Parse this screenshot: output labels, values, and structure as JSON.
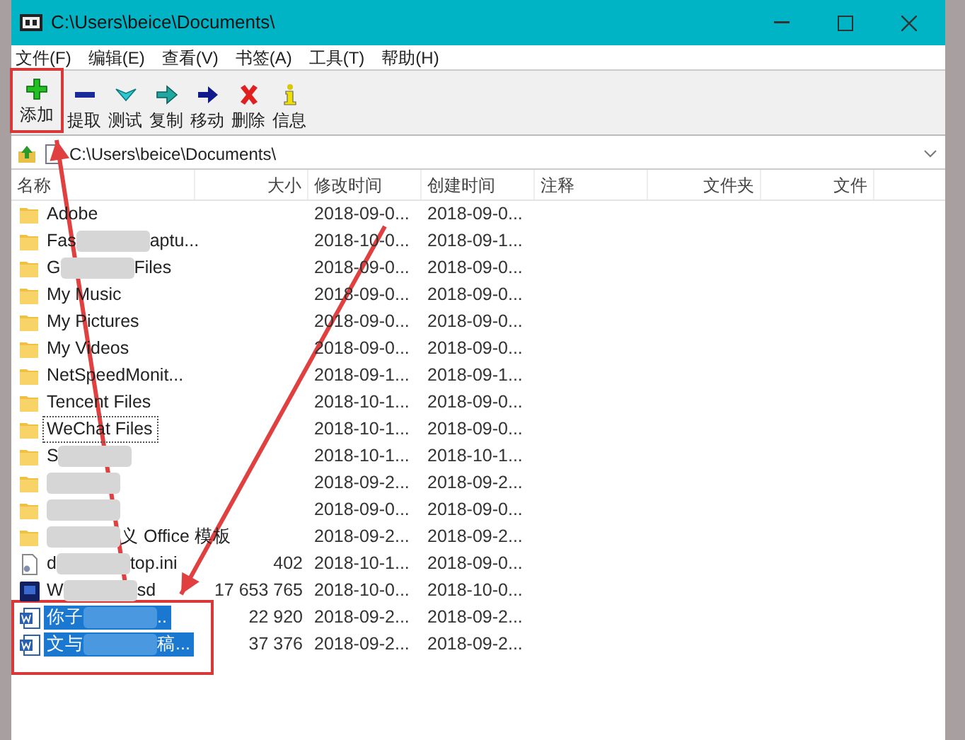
{
  "window": {
    "title": "C:\\Users\\beice\\Documents\\"
  },
  "menu": [
    "文件(F)",
    "编辑(E)",
    "查看(V)",
    "书签(A)",
    "工具(T)",
    "帮助(H)"
  ],
  "toolbar": [
    {
      "kind": "add",
      "label": "添加",
      "highlighted": true
    },
    {
      "kind": "extract",
      "label": "提取",
      "highlighted": false
    },
    {
      "kind": "test",
      "label": "测试",
      "highlighted": false
    },
    {
      "kind": "copy",
      "label": "复制",
      "highlighted": false
    },
    {
      "kind": "move",
      "label": "移动",
      "highlighted": false
    },
    {
      "kind": "delete",
      "label": "删除",
      "highlighted": false
    },
    {
      "kind": "info",
      "label": "信息",
      "highlighted": false
    }
  ],
  "address": {
    "path": "C:\\Users\\beice\\Documents\\"
  },
  "columns": [
    {
      "label": "名称"
    },
    {
      "label": "大小"
    },
    {
      "label": "修改时间"
    },
    {
      "label": "创建时间"
    },
    {
      "label": "注释"
    },
    {
      "label": "文件夹"
    },
    {
      "label": "文件"
    }
  ],
  "rows": [
    {
      "kind": "folder",
      "name": [
        {
          "kind": "text",
          "text": "Adobe"
        }
      ],
      "modified": "2018-09-0...",
      "created": "2018-09-0...",
      "selected": false,
      "focused": false
    },
    {
      "kind": "folder",
      "name": [
        {
          "kind": "text",
          "text": "Fas"
        },
        {
          "kind": "blur"
        },
        {
          "kind": "text",
          "text": "aptu..."
        }
      ],
      "modified": "2018-10-0...",
      "created": "2018-09-1...",
      "selected": false,
      "focused": false
    },
    {
      "kind": "folder",
      "name": [
        {
          "kind": "text",
          "text": "G"
        },
        {
          "kind": "blur"
        },
        {
          "kind": "text",
          "text": "Files"
        }
      ],
      "modified": "2018-09-0...",
      "created": "2018-09-0...",
      "selected": false,
      "focused": false
    },
    {
      "kind": "folder",
      "name": [
        {
          "kind": "text",
          "text": "My Music"
        }
      ],
      "modified": "2018-09-0...",
      "created": "2018-09-0...",
      "selected": false,
      "focused": false
    },
    {
      "kind": "folder",
      "name": [
        {
          "kind": "text",
          "text": "My Pictures"
        }
      ],
      "modified": "2018-09-0...",
      "created": "2018-09-0...",
      "selected": false,
      "focused": false
    },
    {
      "kind": "folder",
      "name": [
        {
          "kind": "text",
          "text": "My Videos"
        }
      ],
      "modified": "2018-09-0...",
      "created": "2018-09-0...",
      "selected": false,
      "focused": false
    },
    {
      "kind": "folder",
      "name": [
        {
          "kind": "text",
          "text": "NetSpeedMonit..."
        }
      ],
      "modified": "2018-09-1...",
      "created": "2018-09-1...",
      "selected": false,
      "focused": false
    },
    {
      "kind": "folder",
      "name": [
        {
          "kind": "text",
          "text": "Tencent Files"
        }
      ],
      "modified": "2018-10-1...",
      "created": "2018-09-0...",
      "selected": false,
      "focused": false
    },
    {
      "kind": "folder",
      "name": [
        {
          "kind": "text",
          "text": "WeChat Files"
        }
      ],
      "modified": "2018-10-1...",
      "created": "2018-09-0...",
      "selected": false,
      "focused": true
    },
    {
      "kind": "folder",
      "name": [
        {
          "kind": "text",
          "text": "S"
        },
        {
          "kind": "blur"
        }
      ],
      "modified": "2018-10-1...",
      "created": "2018-10-1...",
      "selected": false,
      "focused": false
    },
    {
      "kind": "folder",
      "name": [
        {
          "kind": "blur"
        }
      ],
      "modified": "2018-09-2...",
      "created": "2018-09-2...",
      "selected": false,
      "focused": false
    },
    {
      "kind": "folder",
      "name": [
        {
          "kind": "blur"
        }
      ],
      "modified": "2018-09-0...",
      "created": "2018-09-0...",
      "selected": false,
      "focused": false
    },
    {
      "kind": "folder",
      "name": [
        {
          "kind": "blur"
        },
        {
          "kind": "text",
          "text": "义 Office 模板"
        }
      ],
      "modified": "2018-09-2...",
      "created": "2018-09-2...",
      "selected": false,
      "focused": false
    },
    {
      "kind": "ini",
      "name": [
        {
          "kind": "text",
          "text": "d"
        },
        {
          "kind": "blur"
        },
        {
          "kind": "text",
          "text": "top.ini"
        }
      ],
      "size": "402",
      "modified": "2018-10-1...",
      "created": "2018-09-0...",
      "selected": false,
      "focused": false
    },
    {
      "kind": "psd",
      "name": [
        {
          "kind": "text",
          "text": "W"
        },
        {
          "kind": "blur"
        },
        {
          "kind": "text",
          "text": "sd"
        }
      ],
      "size": "17 653 765",
      "modified": "2018-10-0...",
      "created": "2018-10-0...",
      "selected": false,
      "focused": false
    },
    {
      "kind": "word",
      "name": [
        {
          "kind": "text",
          "text": "你子"
        },
        {
          "kind": "blur"
        },
        {
          "kind": "text",
          "text": ".."
        }
      ],
      "size": "22 920",
      "modified": "2018-09-2...",
      "created": "2018-09-2...",
      "selected": true,
      "focused": false
    },
    {
      "kind": "word",
      "name": [
        {
          "kind": "text",
          "text": "文与"
        },
        {
          "kind": "blur"
        },
        {
          "kind": "text",
          "text": "稿..."
        }
      ],
      "size": "37 376",
      "modified": "2018-09-2...",
      "created": "2018-09-2...",
      "selected": true,
      "focused": false
    }
  ],
  "annotations": {
    "selection_box": true,
    "arrows": true
  }
}
